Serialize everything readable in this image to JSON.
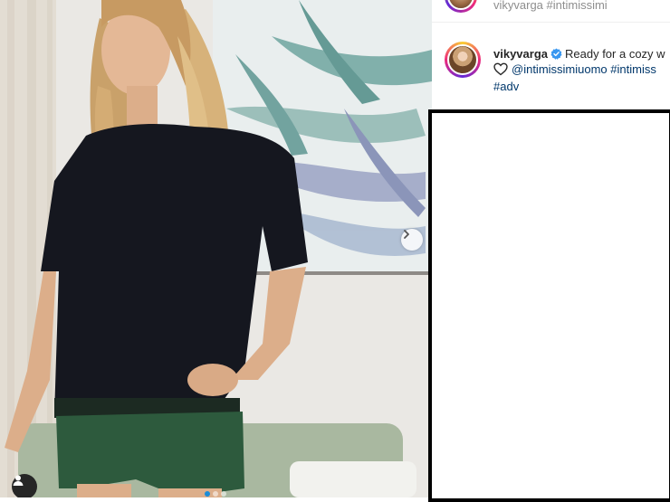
{
  "previous_comment": {
    "text": "vikyvarga #intimissimi"
  },
  "caption": {
    "username": "vikyvarga",
    "text_start": "Ready for a cozy w",
    "mention": "@intimissimiuomo",
    "hashtag_1": "#intimiss",
    "hashtag_2": "#adv"
  },
  "carousel": {
    "slide_count": 3,
    "active_slide": 1
  },
  "icons": {
    "next": "chevron-right-icon",
    "user_tag": "user-icon",
    "verified": "verified-badge-icon",
    "heart": "heart-icon"
  },
  "colors": {
    "link": "#00376b",
    "verified": "#3897f0",
    "carousel_active": "#1a8cd8",
    "tshirt": "#15171f",
    "shorts": "#2d5a3d"
  }
}
